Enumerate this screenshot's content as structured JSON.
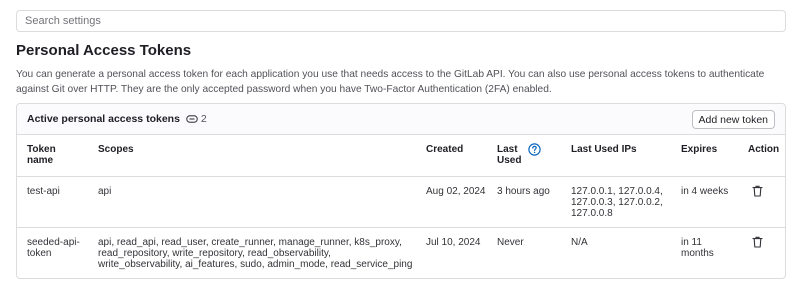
{
  "search": {
    "placeholder": "Search settings"
  },
  "section": {
    "title": "Personal Access Tokens",
    "description": "You can generate a personal access token for each application you use that needs access to the GitLab API. You can also use personal access tokens to authenticate against Git over HTTP. They are the only accepted password when you have Two-Factor Authentication (2FA) enabled."
  },
  "card": {
    "title": "Active personal access tokens",
    "count": "2",
    "add_button": "Add new token"
  },
  "table": {
    "headers": {
      "name": "Token name",
      "scopes": "Scopes",
      "created": "Created",
      "last_used": "Last Used",
      "last_used_ips": "Last Used IPs",
      "expires": "Expires",
      "action": "Action"
    },
    "rows": [
      {
        "name": "test-api",
        "scopes": "api",
        "created": "Aug 02, 2024",
        "last_used": "3 hours ago",
        "last_used_ips": "127.0.0.1, 127.0.0.4, 127.0.0.3, 127.0.0.2, 127.0.0.8",
        "expires": "in 4 weeks"
      },
      {
        "name": "seeded-api-token",
        "scopes": "api, read_api, read_user, create_runner, manage_runner, k8s_proxy, read_repository, write_repository, read_observability, write_observability, ai_features, sudo, admin_mode, read_service_ping",
        "created": "Jul 10, 2024",
        "last_used": "Never",
        "last_used_ips": "N/A",
        "expires": "in 11 months"
      }
    ]
  },
  "icons": {
    "help": "question-circle-icon",
    "token": "token-icon",
    "delete": "trash-icon"
  },
  "colors": {
    "help_icon": "#1068bf",
    "border": "#dcdcde",
    "header_bg": "#fbfafd"
  }
}
